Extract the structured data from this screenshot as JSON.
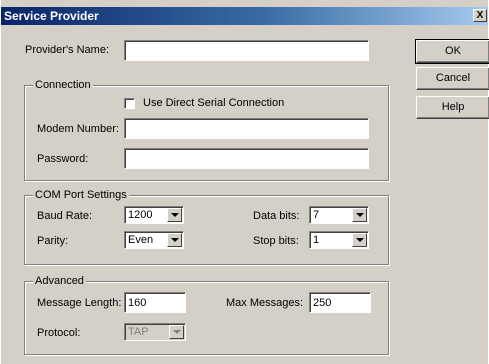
{
  "window": {
    "title": "Service Provider",
    "close_glyph": "X"
  },
  "provider_name": {
    "label": "Provider's Name:",
    "value": ""
  },
  "connection": {
    "title": "Connection",
    "direct_serial_label": "Use Direct Serial Connection",
    "modem_label": "Modem Number:",
    "modem_value": "",
    "password_label": "Password:",
    "password_value": ""
  },
  "com_port": {
    "title": "COM Port Settings",
    "baud_label": "Baud Rate:",
    "baud_value": "1200",
    "parity_label": "Parity:",
    "parity_value": "Even",
    "data_bits_label": "Data bits:",
    "data_bits_value": "7",
    "stop_bits_label": "Stop bits:",
    "stop_bits_value": "1"
  },
  "advanced": {
    "title": "Advanced",
    "msg_length_label": "Message Length:",
    "msg_length_value": "160",
    "max_messages_label": "Max Messages:",
    "max_messages_value": "250",
    "protocol_label": "Protocol:",
    "protocol_value": "TAP"
  },
  "buttons": {
    "ok": "OK",
    "cancel": "Cancel",
    "help": "Help"
  }
}
